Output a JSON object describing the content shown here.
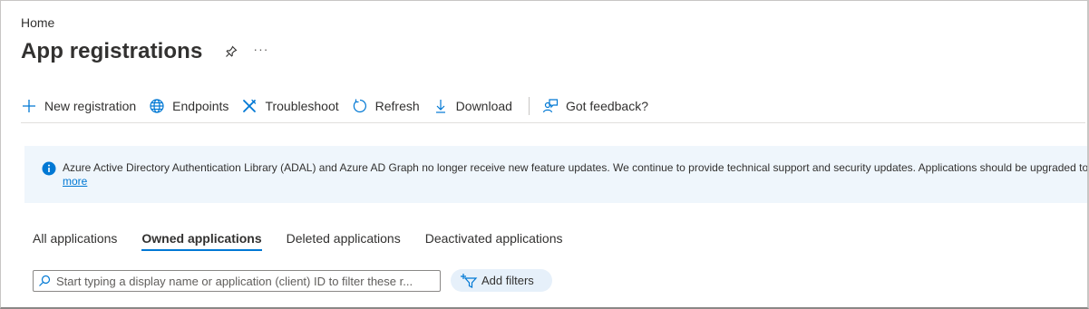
{
  "breadcrumb": {
    "home": "Home"
  },
  "header": {
    "title": "App registrations",
    "more": "···"
  },
  "toolbar": {
    "new_registration": "New registration",
    "endpoints": "Endpoints",
    "troubleshoot": "Troubleshoot",
    "refresh": "Refresh",
    "download": "Download",
    "feedback": "Got feedback?"
  },
  "banner": {
    "text": "Azure Active Directory Authentication Library (ADAL) and Azure AD Graph no longer receive new feature updates. We continue to provide technical support and security updates. Applications should be upgraded to",
    "link": "more"
  },
  "tabs": [
    {
      "label": "All applications"
    },
    {
      "label": "Owned applications"
    },
    {
      "label": "Deleted applications"
    },
    {
      "label": "Deactivated applications"
    }
  ],
  "search": {
    "placeholder": "Start typing a display name or application (client) ID to filter these r..."
  },
  "filters": {
    "label": "Add filters"
  },
  "colors": {
    "accent": "#0078d4",
    "banner_bg": "#eff6fc",
    "filter_bg": "#e6f0fa"
  },
  "icons": {
    "pin": "pin-icon",
    "plus": "plus-icon",
    "globe": "globe-icon",
    "tools": "tools-icon",
    "refresh": "refresh-icon",
    "download": "download-icon",
    "feedback": "feedback-icon",
    "info": "info-icon",
    "search": "search-icon",
    "filter": "filter-add-icon"
  }
}
